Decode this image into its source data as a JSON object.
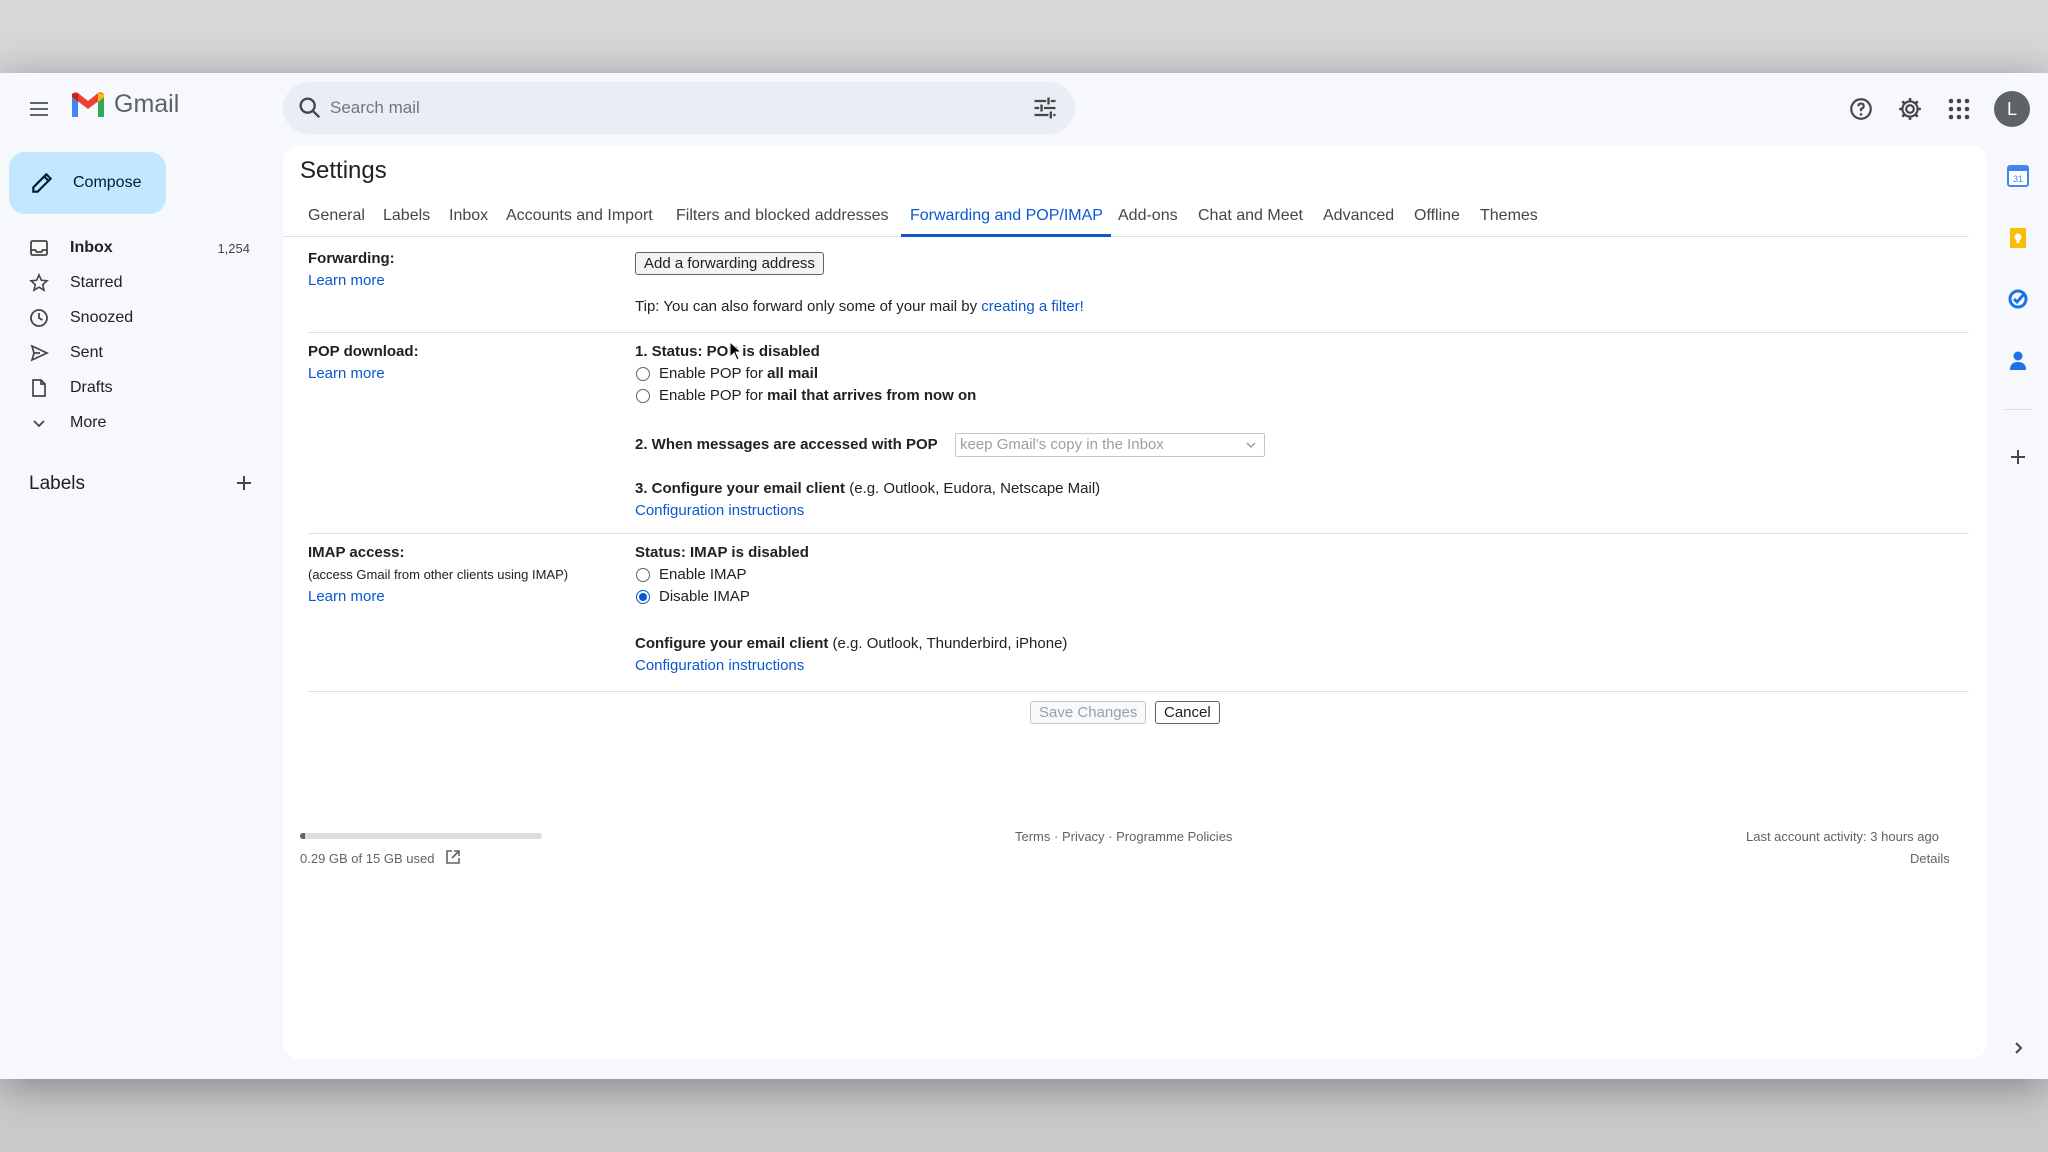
{
  "app": {
    "name": "Gmail"
  },
  "search": {
    "placeholder": "Search mail"
  },
  "user": {
    "avatar_letter": "L"
  },
  "sidebar": {
    "compose_label": "Compose",
    "items": [
      {
        "label": "Inbox",
        "count": "1,254",
        "icon": "inbox-icon"
      },
      {
        "label": "Starred",
        "icon": "star-icon"
      },
      {
        "label": "Snoozed",
        "icon": "clock-icon"
      },
      {
        "label": "Sent",
        "icon": "send-icon"
      },
      {
        "label": "Drafts",
        "icon": "draft-icon"
      },
      {
        "label": "More",
        "icon": "chevron-down-icon"
      }
    ],
    "labels_heading": "Labels"
  },
  "settings": {
    "title": "Settings",
    "tabs": [
      "General",
      "Labels",
      "Inbox",
      "Accounts and Import",
      "Filters and blocked addresses",
      "Forwarding and POP/IMAP",
      "Add-ons",
      "Chat and Meet",
      "Advanced",
      "Offline",
      "Themes"
    ],
    "active_tab": "Forwarding and POP/IMAP",
    "forwarding": {
      "label": "Forwarding:",
      "learn_more": "Learn more",
      "add_button": "Add a forwarding address",
      "tip_prefix": "Tip: You can also forward only some of your mail by ",
      "tip_link": "creating a filter!"
    },
    "pop": {
      "label": "POP download:",
      "learn_more": "Learn more",
      "status": "1. Status: POP is disabled",
      "opt1_prefix": "Enable POP for ",
      "opt1_bold": "all mail",
      "opt2_prefix": "Enable POP for ",
      "opt2_bold": "mail that arrives from now on",
      "step2": "2. When messages are accessed with POP",
      "step2_select": "keep Gmail's copy in the Inbox",
      "step3_bold": "3. Configure your email client",
      "step3_rest": " (e.g. Outlook, Eudora, Netscape Mail)",
      "config_link": "Configuration instructions"
    },
    "imap": {
      "label": "IMAP access:",
      "sublabel": "(access Gmail from other clients using IMAP)",
      "learn_more": "Learn more",
      "status": "Status: IMAP is disabled",
      "enable": "Enable IMAP",
      "disable": "Disable IMAP",
      "selected": "Disable IMAP",
      "configure_bold": "Configure your email client",
      "configure_rest": " (e.g. Outlook, Thunderbird, iPhone)",
      "config_link": "Configuration instructions"
    },
    "save_button": "Save Changes",
    "cancel_button": "Cancel"
  },
  "footer": {
    "storage_text": "0.29 GB of 15 GB used",
    "storage_fraction": 0.02,
    "links": "Terms · Privacy · Programme Policies",
    "activity": "Last account activity: 3 hours ago",
    "details": "Details"
  },
  "colors": {
    "accent": "#0b57d0",
    "compose_bg": "#c2e7ff",
    "app_bg": "#f6f8fc"
  }
}
